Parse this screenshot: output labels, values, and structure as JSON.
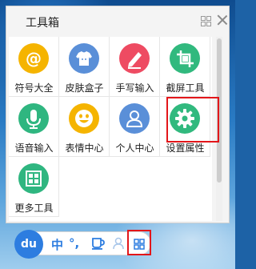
{
  "panel": {
    "title": "工具箱"
  },
  "tools": [
    {
      "label": "符号大全",
      "icon": "at-symbol-icon",
      "color": "#f5b400"
    },
    {
      "label": "皮肤盒子",
      "icon": "tshirt-icon",
      "color": "#5a8fd8"
    },
    {
      "label": "手写输入",
      "icon": "pencil-icon",
      "color": "#ee4b62"
    },
    {
      "label": "截屏工具",
      "icon": "crop-icon",
      "color": "#31b97e"
    },
    {
      "label": "语音输入",
      "icon": "microphone-icon",
      "color": "#2fb680"
    },
    {
      "label": "表情中心",
      "icon": "smiley-icon",
      "color": "#f5b400"
    },
    {
      "label": "个人中心",
      "icon": "user-icon",
      "color": "#5a8fd8"
    },
    {
      "label": "设置属性",
      "icon": "gear-icon",
      "color": "#31b97e"
    },
    {
      "label": "更多工具",
      "icon": "grid-icon",
      "color": "#2fb680"
    }
  ],
  "toolbar": {
    "logo": "du",
    "lang": "中",
    "punct": "°,",
    "accent_color": "#2d7de0"
  },
  "highlight_color": "#e3161a"
}
